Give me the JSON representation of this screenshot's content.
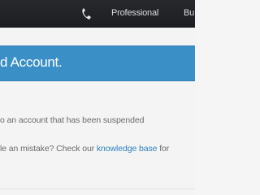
{
  "topbar": {
    "phone_icon": "phone-icon",
    "nav_item_1": "Professional",
    "nav_item_2": "Bu"
  },
  "banner": {
    "title": "d Account."
  },
  "content": {
    "line1": "o an account that has been suspended",
    "line2_prefix": "le an mistake? Check our",
    "line2_link": "knowledge base",
    "line2_suffix": "for"
  },
  "colors": {
    "topbar_bg": "#1f2124",
    "banner_bg": "#3a8fc6",
    "link": "#2b7fbf",
    "body_text": "#6a6a6a"
  }
}
